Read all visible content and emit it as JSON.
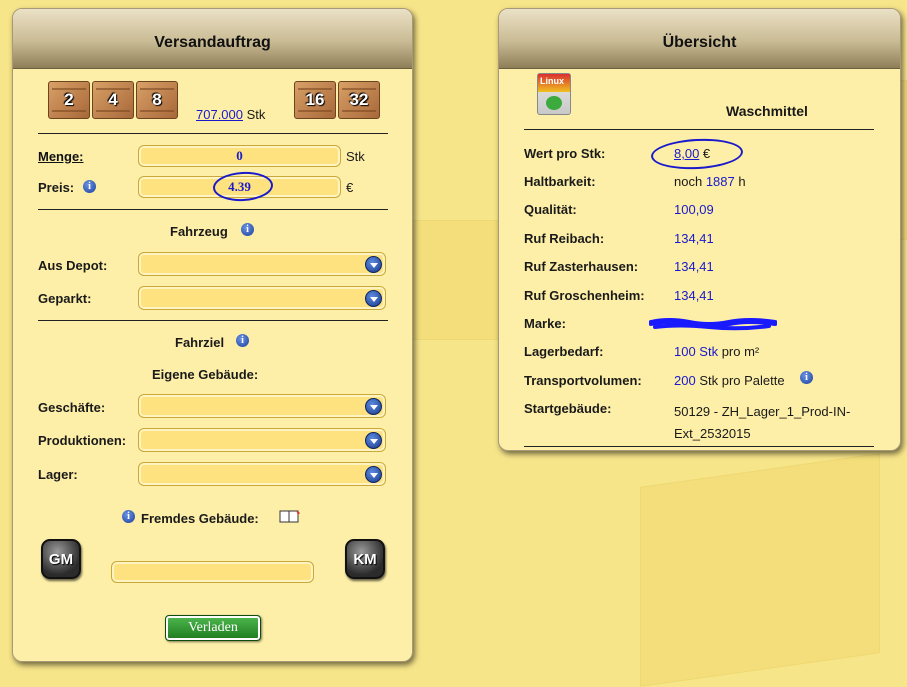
{
  "left": {
    "title": "Versandauftrag",
    "crates": [
      "2",
      "4",
      "8",
      "16",
      "32"
    ],
    "stock_amount": "707.000",
    "stock_unit": "Stk",
    "menge_label": "Menge:",
    "menge_value": "0",
    "menge_unit": "Stk",
    "preis_label": "Preis:",
    "preis_value": "4.39",
    "preis_unit": "€",
    "fahrzeug_heading": "Fahrzeug",
    "aus_depot_label": "Aus Depot:",
    "geparkt_label": "Geparkt:",
    "fahrziel_heading": "Fahrziel",
    "eigene_heading": "Eigene Gebäude:",
    "geschaefte_label": "Geschäfte:",
    "produktionen_label": "Produktionen:",
    "lager_label": "Lager:",
    "fremdes_label": "Fremdes Gebäude:",
    "gm_label": "GM",
    "km_label": "KM",
    "submit_label": "Verladen"
  },
  "right": {
    "title": "Übersicht",
    "product_name": "Waschmittel",
    "product_brand_logo": "Linux",
    "rows": [
      {
        "label": "Wert pro Stk:",
        "value": "8,00",
        "suffix": " €"
      },
      {
        "label": "Haltbarkeit:",
        "prefix": "noch ",
        "value": "1887",
        "suffix": " h"
      },
      {
        "label": "Qualität:",
        "value": "100,09"
      },
      {
        "label": "Ruf Reibach:",
        "value": "134,41"
      },
      {
        "label": "Ruf Zasterhausen:",
        "value": "134,41"
      },
      {
        "label": "Ruf Groschenheim:",
        "value": "134,41"
      },
      {
        "label": "Marke:",
        "value": ""
      },
      {
        "label": "Lagerbedarf:",
        "value": "100 Stk",
        "suffix": " pro m²"
      },
      {
        "label": "Transportvolumen:",
        "value": "200",
        "suffix": " Stk pro Palette"
      },
      {
        "label": "Startgebäude:",
        "value": "50129 - ZH_Lager_1_Prod-IN-Ext_2532015"
      }
    ]
  },
  "colors": {
    "background": "#f7e58a",
    "panel": "#fdefa8",
    "link_blue": "#1a1acc",
    "field_fill": "#fde27f",
    "button_green": "#2e8f2e"
  }
}
